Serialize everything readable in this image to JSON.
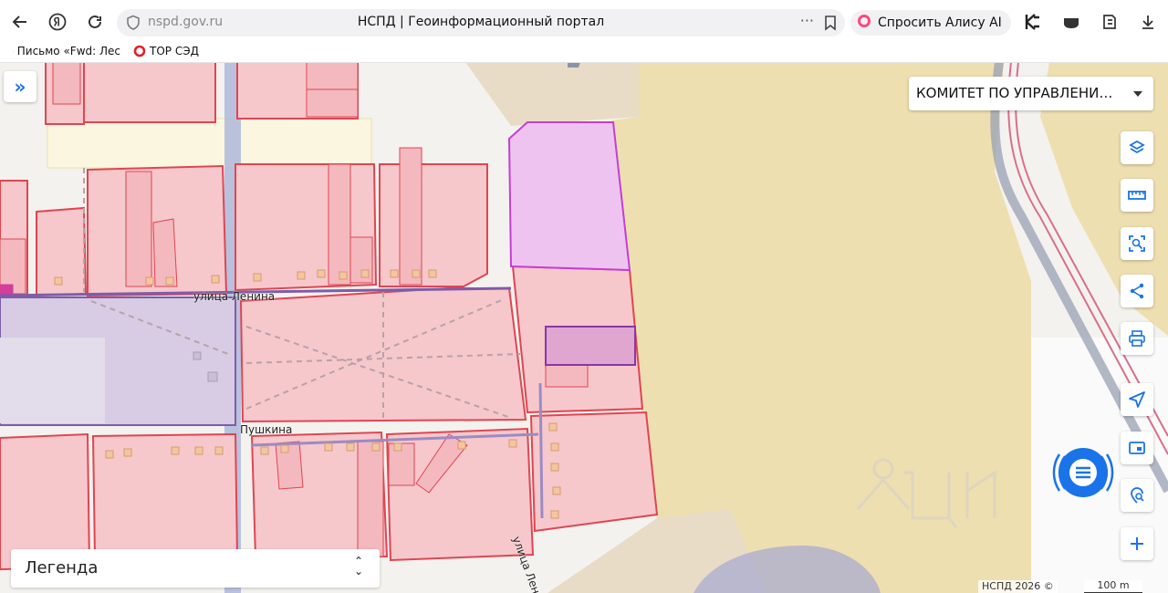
{
  "browser": {
    "host": "nspd.gov.ru",
    "page_title": "НСПД | Геоинформационный портал",
    "alice_label": "Спросить Алису AI",
    "bookmarks": [
      {
        "label": "Письмо «Fwd: Лес"
      },
      {
        "label": "ТОР СЭД"
      }
    ]
  },
  "map": {
    "organization_select": "КОМИТЕТ ПО УПРАВЛЕНИЮ ИМУЩЕСТВОМ",
    "legend_label": "Легенда",
    "copyright": "НСПД 2026 ©",
    "scale_label": "100 m",
    "streets": {
      "lenina_top": "улица Ленина",
      "pushkina": "Пушкина",
      "lenina_right": "улица Ленина"
    },
    "tools": [
      "layers-icon",
      "ruler-icon",
      "area-select-icon",
      "share-icon",
      "print-icon",
      "navigate-icon",
      "frame-icon",
      "geo-search-icon",
      "zoom-in-icon"
    ],
    "colors": {
      "parcel_fill": "#f6c8cc",
      "parcel_stroke": "#e04552",
      "selected_fill": "#efc3f0",
      "selected_stroke": "#c53ed4",
      "zone_fill": "#eedfb0",
      "accent": "#1a73e8"
    }
  }
}
